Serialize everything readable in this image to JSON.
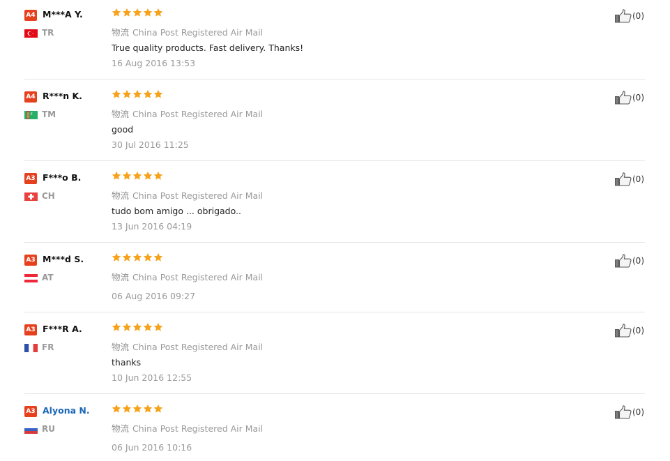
{
  "reviews": [
    {
      "level": "A4",
      "buyer": "M***A Y.",
      "country": "TR",
      "flag_icon": "turkey-flag-icon",
      "rating": 5,
      "logistics_label": "物流",
      "logistics": "China Post Registered Air Mail",
      "text": "True quality products. Fast delivery. Thanks!",
      "date": "16 Aug 2016 13:53",
      "helpful": "(0)"
    },
    {
      "level": "A4",
      "buyer": "R***n K.",
      "country": "TM",
      "flag_icon": "turkmenistan-flag-icon",
      "rating": 5,
      "logistics_label": "物流",
      "logistics": "China Post Registered Air Mail",
      "text": "good",
      "date": "30 Jul 2016 11:25",
      "helpful": "(0)"
    },
    {
      "level": "A3",
      "buyer": "F***o B.",
      "country": "CH",
      "flag_icon": "switzerland-flag-icon",
      "rating": 5,
      "logistics_label": "物流",
      "logistics": "China Post Registered Air Mail",
      "text": "tudo bom amigo ... obrigado..",
      "date": "13 Jun 2016 04:19",
      "helpful": "(0)"
    },
    {
      "level": "A3",
      "buyer": "M***d S.",
      "country": "AT",
      "flag_icon": "austria-flag-icon",
      "rating": 5,
      "logistics_label": "物流",
      "logistics": "China Post Registered Air Mail",
      "text": "",
      "date": "06 Aug 2016 09:27",
      "helpful": "(0)"
    },
    {
      "level": "A3",
      "buyer": "F***R A.",
      "country": "FR",
      "flag_icon": "france-flag-icon",
      "rating": 5,
      "logistics_label": "物流",
      "logistics": "China Post Registered Air Mail",
      "text": "thanks",
      "date": "10 Jun 2016 12:55",
      "helpful": "(0)"
    },
    {
      "level": "A3",
      "buyer": "Alyona N.",
      "country": "RU",
      "flag_icon": "russia-flag-icon",
      "rating": 5,
      "logistics_label": "物流",
      "logistics": "China Post Registered Air Mail",
      "text": "",
      "date": "06 Jun 2016 10:16",
      "helpful": "(0)"
    }
  ],
  "colors": {
    "level_badge": "#e6411e",
    "star": "#f7a21b",
    "buyer_link": "#1a66b8",
    "muted_text": "#999999",
    "separator": "#e6e6e6"
  }
}
